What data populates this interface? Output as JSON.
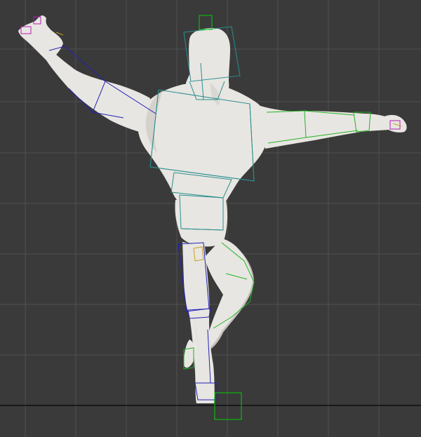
{
  "viewport": {
    "background": "#3a3a3a",
    "grid_color": "#505050",
    "ground_line_color": "#0e0e0e",
    "mesh_fill": "#e8e6e2",
    "mesh_shadow": "#c4c1bc"
  },
  "rig": {
    "color_left_side": "#2323b4",
    "color_spine": "#2a8f8f",
    "color_right_side": "#22b422",
    "color_hand": "#b41eb4",
    "color_foot_control": "#00d000",
    "color_accent": "#c8a020"
  }
}
